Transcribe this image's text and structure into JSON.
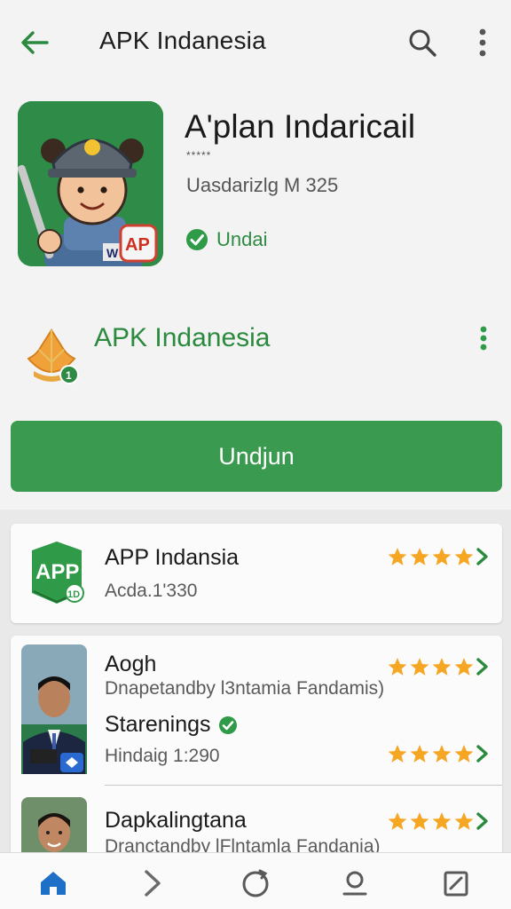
{
  "appbar": {
    "title": "APK Indanesia",
    "back_icon": "arrow-left-icon",
    "search_icon": "search-icon",
    "more_icon": "more-vertical-icon"
  },
  "hero": {
    "app_name": "A'plan Indaricail",
    "stars_text": "*****",
    "meta": "Uasdarizlg M 325",
    "verified_label": "Undai",
    "icon_badge": "AP",
    "icon_tag": "W"
  },
  "developer": {
    "name": "APK Indanesia",
    "badge": "1"
  },
  "install_button": {
    "label": "Undjun"
  },
  "list": [
    {
      "title": "APP Indansia",
      "subtitle": "Acda.1'330",
      "icon_text": "APP",
      "icon_badge": "1D",
      "rating": 4
    },
    {
      "title": "Aogh",
      "subtitle": "Dnapetandby l3ntamia Fandamis)",
      "rating": 4
    },
    {
      "title": "Starenings",
      "subtitle": "Hindaig 1:290",
      "rating": 4
    },
    {
      "title": "Dapkalingtana",
      "subtitle": "Dranctandby lFlntamla Fandanja)",
      "rating": 4
    }
  ],
  "bottom_nav": [
    {
      "icon": "home-icon",
      "active": true
    },
    {
      "icon": "chevron-right-icon",
      "active": false
    },
    {
      "icon": "refresh-icon",
      "active": false
    },
    {
      "icon": "profile-icon",
      "active": false
    },
    {
      "icon": "edit-note-icon",
      "active": false
    }
  ],
  "colors": {
    "primary_green": "#3a9a4f",
    "text_green": "#2b8a3e",
    "star_orange": "#f5a623",
    "nav_active": "#1e6fc8"
  }
}
